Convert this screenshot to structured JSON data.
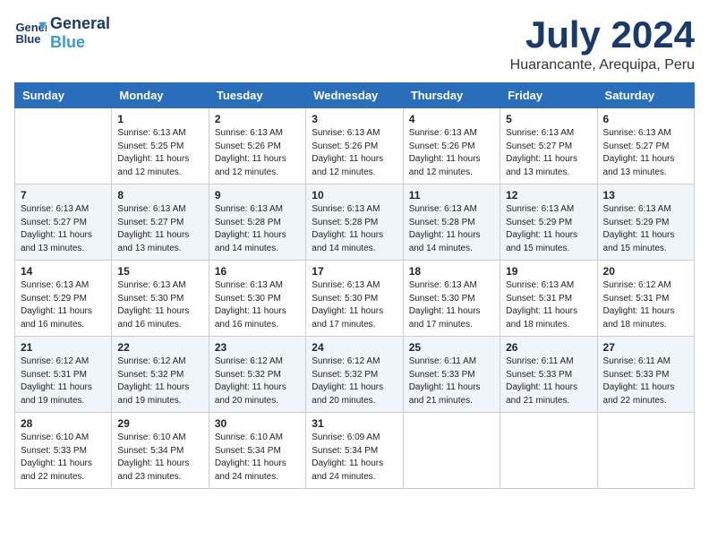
{
  "header": {
    "logo_line1": "General",
    "logo_line2": "Blue",
    "month_title": "July 2024",
    "location": "Huarancante, Arequipa, Peru"
  },
  "weekdays": [
    "Sunday",
    "Monday",
    "Tuesday",
    "Wednesday",
    "Thursday",
    "Friday",
    "Saturday"
  ],
  "weeks": [
    [
      {
        "day": "",
        "info": ""
      },
      {
        "day": "1",
        "info": "Sunrise: 6:13 AM\nSunset: 5:25 PM\nDaylight: 11 hours\nand 12 minutes."
      },
      {
        "day": "2",
        "info": "Sunrise: 6:13 AM\nSunset: 5:26 PM\nDaylight: 11 hours\nand 12 minutes."
      },
      {
        "day": "3",
        "info": "Sunrise: 6:13 AM\nSunset: 5:26 PM\nDaylight: 11 hours\nand 12 minutes."
      },
      {
        "day": "4",
        "info": "Sunrise: 6:13 AM\nSunset: 5:26 PM\nDaylight: 11 hours\nand 12 minutes."
      },
      {
        "day": "5",
        "info": "Sunrise: 6:13 AM\nSunset: 5:27 PM\nDaylight: 11 hours\nand 13 minutes."
      },
      {
        "day": "6",
        "info": "Sunrise: 6:13 AM\nSunset: 5:27 PM\nDaylight: 11 hours\nand 13 minutes."
      }
    ],
    [
      {
        "day": "7",
        "info": "Sunrise: 6:13 AM\nSunset: 5:27 PM\nDaylight: 11 hours\nand 13 minutes."
      },
      {
        "day": "8",
        "info": "Sunrise: 6:13 AM\nSunset: 5:27 PM\nDaylight: 11 hours\nand 13 minutes."
      },
      {
        "day": "9",
        "info": "Sunrise: 6:13 AM\nSunset: 5:28 PM\nDaylight: 11 hours\nand 14 minutes."
      },
      {
        "day": "10",
        "info": "Sunrise: 6:13 AM\nSunset: 5:28 PM\nDaylight: 11 hours\nand 14 minutes."
      },
      {
        "day": "11",
        "info": "Sunrise: 6:13 AM\nSunset: 5:28 PM\nDaylight: 11 hours\nand 14 minutes."
      },
      {
        "day": "12",
        "info": "Sunrise: 6:13 AM\nSunset: 5:29 PM\nDaylight: 11 hours\nand 15 minutes."
      },
      {
        "day": "13",
        "info": "Sunrise: 6:13 AM\nSunset: 5:29 PM\nDaylight: 11 hours\nand 15 minutes."
      }
    ],
    [
      {
        "day": "14",
        "info": "Sunrise: 6:13 AM\nSunset: 5:29 PM\nDaylight: 11 hours\nand 16 minutes."
      },
      {
        "day": "15",
        "info": "Sunrise: 6:13 AM\nSunset: 5:30 PM\nDaylight: 11 hours\nand 16 minutes."
      },
      {
        "day": "16",
        "info": "Sunrise: 6:13 AM\nSunset: 5:30 PM\nDaylight: 11 hours\nand 16 minutes."
      },
      {
        "day": "17",
        "info": "Sunrise: 6:13 AM\nSunset: 5:30 PM\nDaylight: 11 hours\nand 17 minutes."
      },
      {
        "day": "18",
        "info": "Sunrise: 6:13 AM\nSunset: 5:30 PM\nDaylight: 11 hours\nand 17 minutes."
      },
      {
        "day": "19",
        "info": "Sunrise: 6:13 AM\nSunset: 5:31 PM\nDaylight: 11 hours\nand 18 minutes."
      },
      {
        "day": "20",
        "info": "Sunrise: 6:12 AM\nSunset: 5:31 PM\nDaylight: 11 hours\nand 18 minutes."
      }
    ],
    [
      {
        "day": "21",
        "info": "Sunrise: 6:12 AM\nSunset: 5:31 PM\nDaylight: 11 hours\nand 19 minutes."
      },
      {
        "day": "22",
        "info": "Sunrise: 6:12 AM\nSunset: 5:32 PM\nDaylight: 11 hours\nand 19 minutes."
      },
      {
        "day": "23",
        "info": "Sunrise: 6:12 AM\nSunset: 5:32 PM\nDaylight: 11 hours\nand 20 minutes."
      },
      {
        "day": "24",
        "info": "Sunrise: 6:12 AM\nSunset: 5:32 PM\nDaylight: 11 hours\nand 20 minutes."
      },
      {
        "day": "25",
        "info": "Sunrise: 6:11 AM\nSunset: 5:33 PM\nDaylight: 11 hours\nand 21 minutes."
      },
      {
        "day": "26",
        "info": "Sunrise: 6:11 AM\nSunset: 5:33 PM\nDaylight: 11 hours\nand 21 minutes."
      },
      {
        "day": "27",
        "info": "Sunrise: 6:11 AM\nSunset: 5:33 PM\nDaylight: 11 hours\nand 22 minutes."
      }
    ],
    [
      {
        "day": "28",
        "info": "Sunrise: 6:10 AM\nSunset: 5:33 PM\nDaylight: 11 hours\nand 22 minutes."
      },
      {
        "day": "29",
        "info": "Sunrise: 6:10 AM\nSunset: 5:34 PM\nDaylight: 11 hours\nand 23 minutes."
      },
      {
        "day": "30",
        "info": "Sunrise: 6:10 AM\nSunset: 5:34 PM\nDaylight: 11 hours\nand 24 minutes."
      },
      {
        "day": "31",
        "info": "Sunrise: 6:09 AM\nSunset: 5:34 PM\nDaylight: 11 hours\nand 24 minutes."
      },
      {
        "day": "",
        "info": ""
      },
      {
        "day": "",
        "info": ""
      },
      {
        "day": "",
        "info": ""
      }
    ]
  ]
}
